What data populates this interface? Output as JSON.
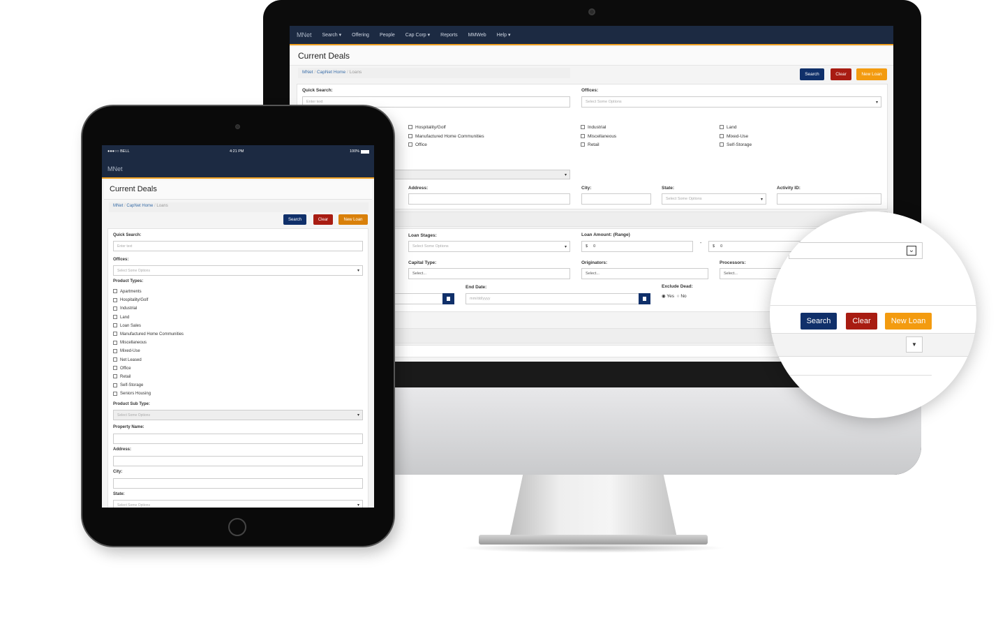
{
  "desktop": {
    "nav": {
      "brand": "MNet",
      "items": [
        "Search ▾",
        "Offering",
        "People",
        "Cap Corp ▾",
        "Reports",
        "MMWeb",
        "Help ▾"
      ]
    },
    "title": "Current Deals",
    "breadcrumb": [
      "MNet",
      "CapNet Home",
      "Loans"
    ],
    "buttons": {
      "search": "Search",
      "clear": "Clear",
      "new_loan": "New Loan"
    },
    "quick_search": {
      "label": "Quick Search:",
      "placeholder": "Enter text"
    },
    "offices": {
      "label": "Offices:",
      "placeholder": "Select Some Options"
    },
    "product_types": [
      "Hospitality/Golf",
      "Manufactured Home Communities",
      "Office",
      "Industrial",
      "Miscellaneous",
      "Retail",
      "Land",
      "Mixed-Use",
      "Self-Storage"
    ],
    "address": {
      "label": "Address:"
    },
    "city": {
      "label": "City:"
    },
    "state": {
      "label": "State:",
      "placeholder": "Select Some Options"
    },
    "activity_id": {
      "label": "Activity ID:"
    },
    "loan_stages": {
      "label": "Loan Stages:",
      "placeholder": "Select Some Options"
    },
    "loan_amount": {
      "label": "Loan Amount: (Range)",
      "currency": "$",
      "min": "0",
      "max": "0",
      "sep": "-"
    },
    "capital_type": {
      "label": "Capital Type:",
      "value": "Select..."
    },
    "originators": {
      "label": "Originators:",
      "value": "Select..."
    },
    "processors": {
      "label": "Processors:",
      "value": "Select..."
    },
    "end_date": {
      "label": "End Date:",
      "placeholder": "mm/dd/yyyy"
    },
    "exclude_dead": {
      "label": "Exclude Dead:",
      "options": [
        "Yes",
        "No"
      ],
      "selected": "Yes"
    }
  },
  "magnifier": {
    "buttons": {
      "search": "Search",
      "clear": "Clear",
      "new_loan": "New Loan"
    }
  },
  "tablet": {
    "status": {
      "carrier": "●●●○○ BELL",
      "time": "4:21 PM",
      "battery": "100%"
    },
    "brand": "MNet",
    "title": "Current Deals",
    "breadcrumb": [
      "MNet",
      "CapNet Home",
      "Loans"
    ],
    "buttons": {
      "search": "Search",
      "clear": "Clear",
      "new_loan": "New Loan"
    },
    "quick_search": {
      "label": "Quick Search:",
      "placeholder": "Enter text"
    },
    "offices": {
      "label": "Offices:",
      "placeholder": "Select Some Options"
    },
    "product_types_label": "Product Types:",
    "product_types": [
      "Apartments",
      "Hospitality/Golf",
      "Industrial",
      "Land",
      "Loan Sales",
      "Manufactured Home Communities",
      "Miscellaneous",
      "Mixed-Use",
      "Net Leased",
      "Office",
      "Retail",
      "Self-Storage",
      "Seniors Housing"
    ],
    "product_sub_type": {
      "label": "Product Sub Type:",
      "placeholder": "Select Some Options"
    },
    "property_name": {
      "label": "Property Name:"
    },
    "address": {
      "label": "Address:"
    },
    "city": {
      "label": "City:"
    },
    "state": {
      "label": "State:",
      "placeholder": "Select Some Options"
    }
  },
  "colors": {
    "navbar": "#1c2a42",
    "accent": "#f0a020",
    "search": "#10306a",
    "clear": "#a81c12",
    "new_loan": "#f39b10"
  }
}
